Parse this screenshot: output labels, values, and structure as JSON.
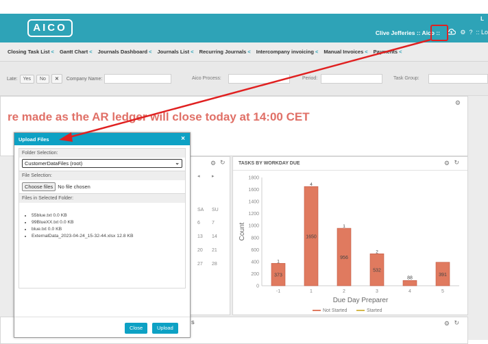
{
  "header": {
    "logo": "AICO",
    "user": "Clive Jefferies :: Aico ::",
    "top_right": "L",
    "icons": [
      "cloud-upload-icon",
      "gear-icon",
      "help-icon",
      "grid-icon"
    ],
    "extra": ":: Lo"
  },
  "nav": {
    "items": [
      {
        "label": "Closing Task List"
      },
      {
        "label": "Gantt Chart"
      },
      {
        "label": "Journals Dashboard"
      },
      {
        "label": "Journals List"
      },
      {
        "label": "Recurring Journals"
      },
      {
        "label": "Intercompany invoicing"
      },
      {
        "label": "Manual Invoices"
      },
      {
        "label": "Payments"
      }
    ]
  },
  "filters": {
    "late_label": "Late:",
    "yes": "Yes",
    "no": "No",
    "clear": "✕",
    "company_label": "Company Name:",
    "process_label": "Aico Process:",
    "period_label": "Period:",
    "group_label": "Task Group:"
  },
  "banner": {
    "text": "re made as the AR ledger will close today at 14:00 CET"
  },
  "calendar": {
    "days": [
      "SA",
      "SU"
    ],
    "rows": [
      [
        "6",
        "7"
      ],
      [
        "13",
        "14"
      ],
      [
        "20",
        "21"
      ],
      [
        "27",
        "28"
      ]
    ]
  },
  "chart_panel": {
    "title": "TASKS BY WORKDAY DUE"
  },
  "chart_data": {
    "type": "bar",
    "categories": [
      "-1",
      "1",
      "2",
      "3",
      "4",
      "5"
    ],
    "series": [
      {
        "name": "Not Started",
        "values": [
          373,
          1650,
          956,
          532,
          88,
          391
        ]
      },
      {
        "name": "Started",
        "values": [
          1,
          4,
          1,
          2,
          0,
          0
        ]
      }
    ],
    "data_labels": [
      "373",
      "1650",
      "956",
      "532",
      "88",
      "391"
    ],
    "top_labels": [
      "1",
      "4",
      "1",
      "2",
      "",
      ""
    ],
    "yticks": [
      "0",
      "200",
      "400",
      "600",
      "800",
      "1000",
      "1200",
      "1400",
      "1600",
      "1800"
    ],
    "ylim": [
      0,
      1800
    ],
    "xlabel": "Due Day Preparer",
    "ylabel": "Count",
    "legend_position": "bottom",
    "colors": {
      "Not Started": "#e07a5f",
      "Started": "#d4b84a"
    }
  },
  "bottom_panel": {
    "title_fragment": "S"
  },
  "modal": {
    "title": "Upload Files",
    "close": "×",
    "folder_label": "Folder Selection:",
    "folder_value": "CustomerDataFiles (root)",
    "file_label": "File Selection:",
    "choose_button": "Choose files",
    "no_file": "No file chosen",
    "list_label": "Files in Selected Folder:",
    "files": [
      "55blue.txt 0.0 KB",
      "99BlueXX.txt 0.0 KB",
      "blue.txt 0.0 KB",
      "ExternalData_2023-04-24_15-32-44.xlsx 12.8 KB"
    ],
    "close_button": "Close",
    "upload_button": "Upload"
  },
  "colors": {
    "header": "#2ea3b7",
    "modal_accent": "#0da1c4",
    "annotation": "#e02020"
  }
}
